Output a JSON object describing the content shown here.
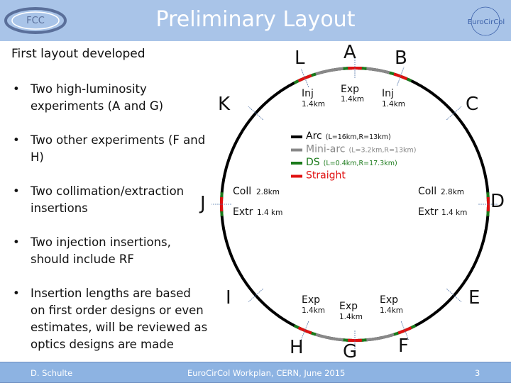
{
  "header": {
    "title": "Preliminary Layout",
    "logo_left": "FCC",
    "logo_right": "EuroCirCol"
  },
  "subtitle": "First layout developed",
  "bullets": [
    "Two high-luminosity experiments (A and G)",
    "Two other experiments (F and H)",
    "Two collimation/extraction insertions",
    "Two injection insertions, should include RF",
    "Insertion lengths are based on first order designs or even estimates, will be reviewed as optics designs are made"
  ],
  "diagram": {
    "points": {
      "A": "A",
      "B": "B",
      "C": "C",
      "D": "D",
      "E": "E",
      "F": "F",
      "G": "G",
      "H": "H",
      "I": "I",
      "J": "J",
      "K": "K",
      "L": "L"
    },
    "labels": {
      "inj_l": "Inj",
      "inj_l_len": "1.4km",
      "exp_a": "Exp",
      "exp_a_len": "1.4km",
      "inj_b": "Inj",
      "inj_b_len": "1.4km",
      "coll_j": "Coll",
      "coll_j_len": "2.8km",
      "extr_j": "Extr",
      "extr_j_len": "1.4 km",
      "coll_d": "Coll",
      "coll_d_len": "2.8km",
      "extr_d": "Extr",
      "extr_d_len": "1.4 km",
      "exp_h": "Exp",
      "exp_h_len": "1.4km",
      "exp_g": "Exp",
      "exp_g_len": "1.4km",
      "exp_f": "Exp",
      "exp_f_len": "1.4km"
    },
    "legend": [
      {
        "name": "Arc",
        "detail": "(L=16km,R=13km)",
        "color": "#000000"
      },
      {
        "name": "Mini-arc",
        "detail": "(L=3.2km,R=13km)",
        "color": "#888888"
      },
      {
        "name": "DS",
        "detail": "(L=0.4km,R=17.3km)",
        "color": "#1a7a1a"
      },
      {
        "name": "Straight",
        "detail": "",
        "color": "#e01010"
      }
    ]
  },
  "footer": {
    "author": "D. Schulte",
    "event": "EuroCirCol Workplan, CERN, June 2015",
    "page": "3"
  }
}
